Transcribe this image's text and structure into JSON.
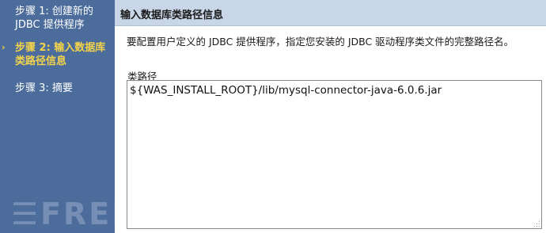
{
  "sidebar": {
    "steps": [
      {
        "label": "步骤 1: 创建新的 JDBC 提供程序",
        "current": false
      },
      {
        "label": "步骤 2: 输入数据库类路径信息",
        "current": true
      },
      {
        "label": "步骤 3: 摘要",
        "current": false
      }
    ]
  },
  "main": {
    "title": "输入数据库类路径信息",
    "description": "要配置用户定义的 JDBC 提供程序，指定您安装的 JDBC 驱动程序类文件的完整路径名。",
    "classpath": {
      "label": "类路径",
      "value": "${WAS_INSTALL_ROOT}/lib/mysql-connector-java-6.0.6.jar"
    }
  },
  "watermark": "FREEBUF",
  "colors": {
    "sidebar_bg": "#4c6c9c",
    "current_step": "#f4d44a",
    "header_bg": "#c8d6e8"
  }
}
